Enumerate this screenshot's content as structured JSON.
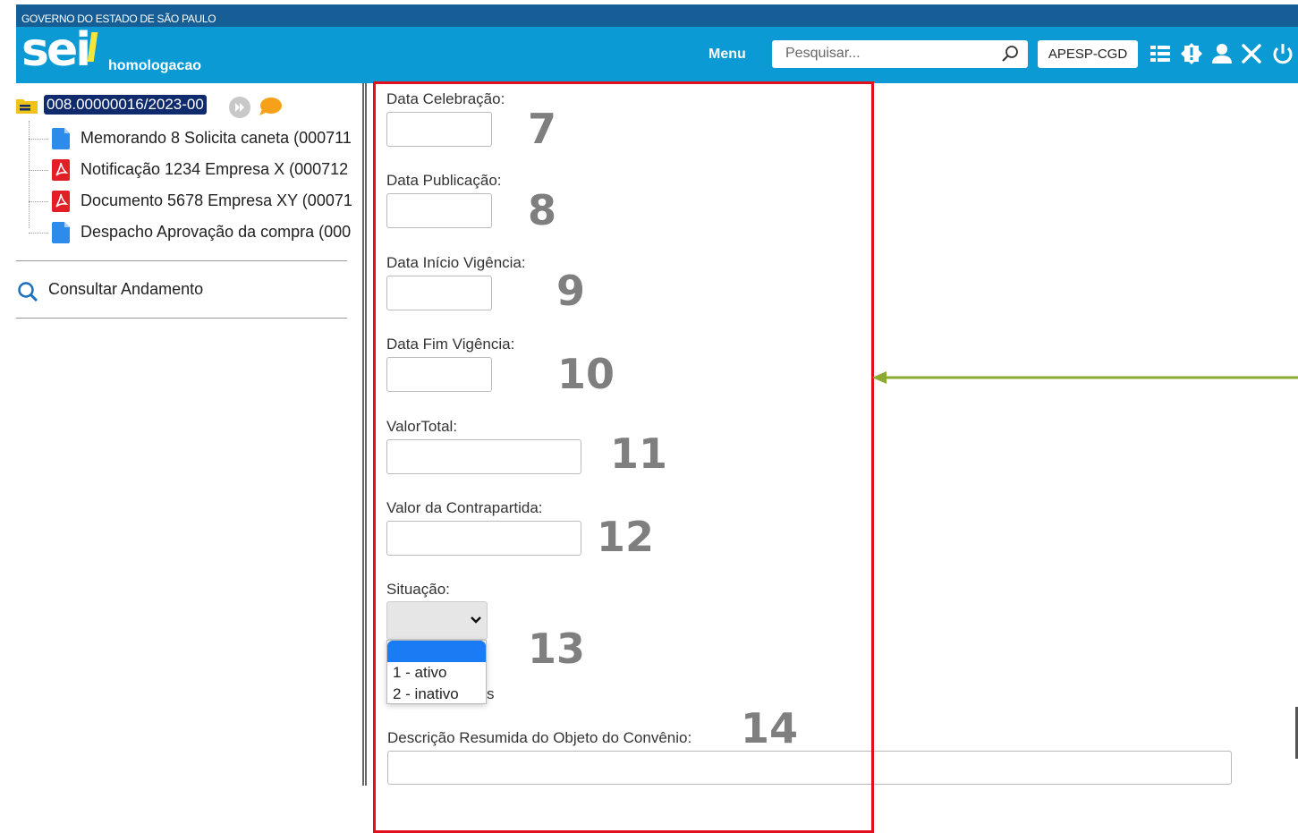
{
  "gov_bar": {
    "text": "GOVERNO DO ESTADO DE SÃO PAULO"
  },
  "header": {
    "logo_text": "sei",
    "environment": "homologacao",
    "menu_label": "Menu",
    "search_placeholder": "Pesquisar...",
    "unit_label": "APESP-CGD",
    "icons": [
      "list-icon",
      "alert-icon",
      "user-icon",
      "tools-icon",
      "power-icon"
    ]
  },
  "sidebar": {
    "process_number": "008.00000016/2023-00",
    "documents": [
      {
        "label": "Memorando 8 Solicita caneta (000711",
        "icon": "internal-document-icon"
      },
      {
        "label": "Notificação 1234 Empresa X (000712",
        "icon": "pdf-icon"
      },
      {
        "label": "Documento 5678 Empresa XY (00071",
        "icon": "pdf-icon"
      },
      {
        "label": "Despacho Aprovação da compra (000",
        "icon": "internal-document-icon"
      }
    ],
    "consult_label": "Consultar Andamento"
  },
  "form": {
    "fields": [
      {
        "label": "Data Celebração:",
        "marker": "7",
        "value": ""
      },
      {
        "label": "Data Publicação:",
        "marker": "8",
        "value": ""
      },
      {
        "label": "Data Início Vigência:",
        "marker": "9",
        "value": ""
      },
      {
        "label": "Data Fim Vigência:",
        "marker": "10",
        "value": ""
      },
      {
        "label": "ValorTotal:",
        "marker": "11",
        "value": ""
      },
      {
        "label": "Valor da Contrapartida:",
        "marker": "12",
        "value": ""
      }
    ],
    "situacao": {
      "label": "Situação:",
      "marker": "13",
      "selected": "",
      "options": [
        "",
        "1 - ativo",
        "2 - inativo"
      ],
      "hidden_fragment": "s"
    },
    "descricao": {
      "label": "Descrição Resumida do Objeto do Convênio:",
      "marker": "14",
      "value": ""
    }
  },
  "colors": {
    "gov_bar": "#155e96",
    "header": "#0b9ad3",
    "highlight_box": "#e2101f",
    "pointer_arrow": "#8aab2f",
    "process_badge": "#0f2b6e",
    "marker_numbers": "#7f7f7f"
  }
}
